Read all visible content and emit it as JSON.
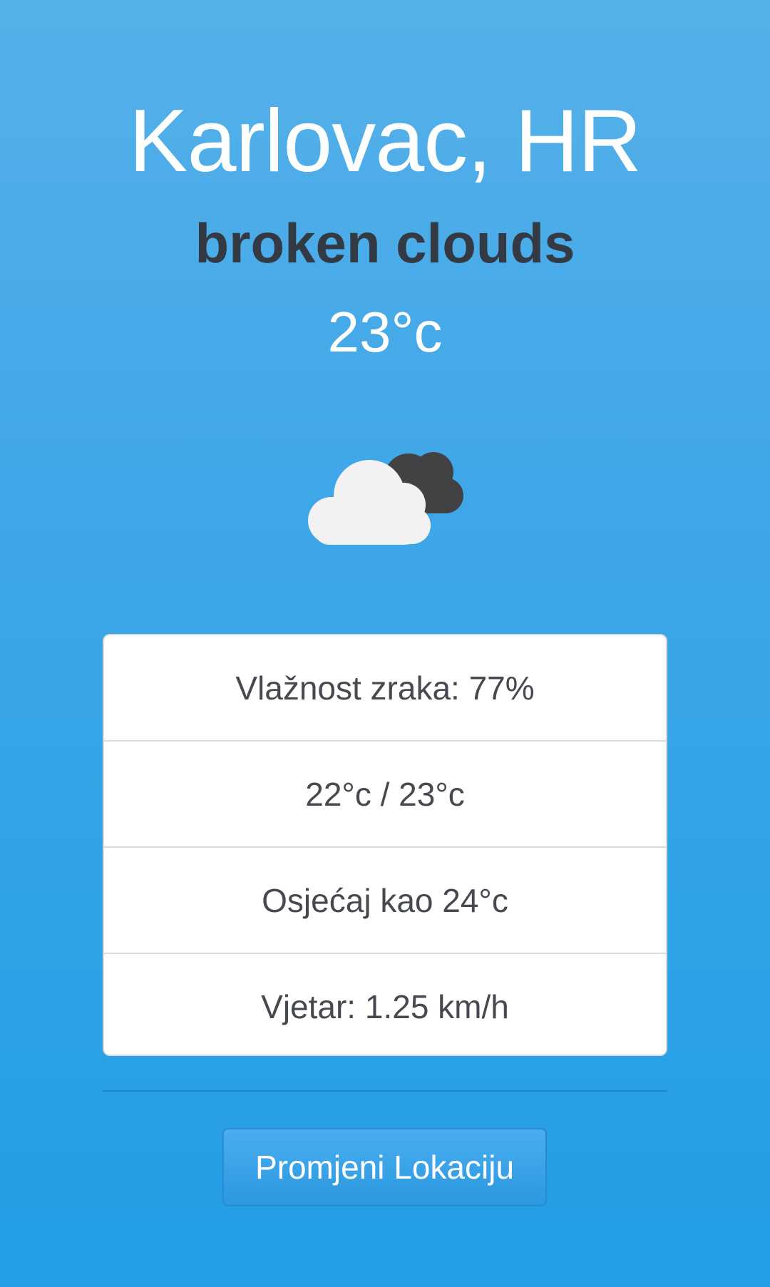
{
  "weather": {
    "location": "Karlovac, HR",
    "description": "broken clouds",
    "temperature": "23°c",
    "icon": "broken-clouds-icon"
  },
  "details": {
    "humidity": "Vlažnost zraka: 77%",
    "min_max": "22°c / 23°c",
    "feels_like": "Osjećaj kao 24°c",
    "wind": "Vjetar: 1.25 km/h"
  },
  "actions": {
    "change_location_label": "Promjeni Lokaciju"
  },
  "colors": {
    "background_top": "#56b0e8",
    "background_bottom": "#229de6",
    "description_text": "#333a44",
    "card_background": "#ffffff",
    "card_text": "#464a50"
  }
}
